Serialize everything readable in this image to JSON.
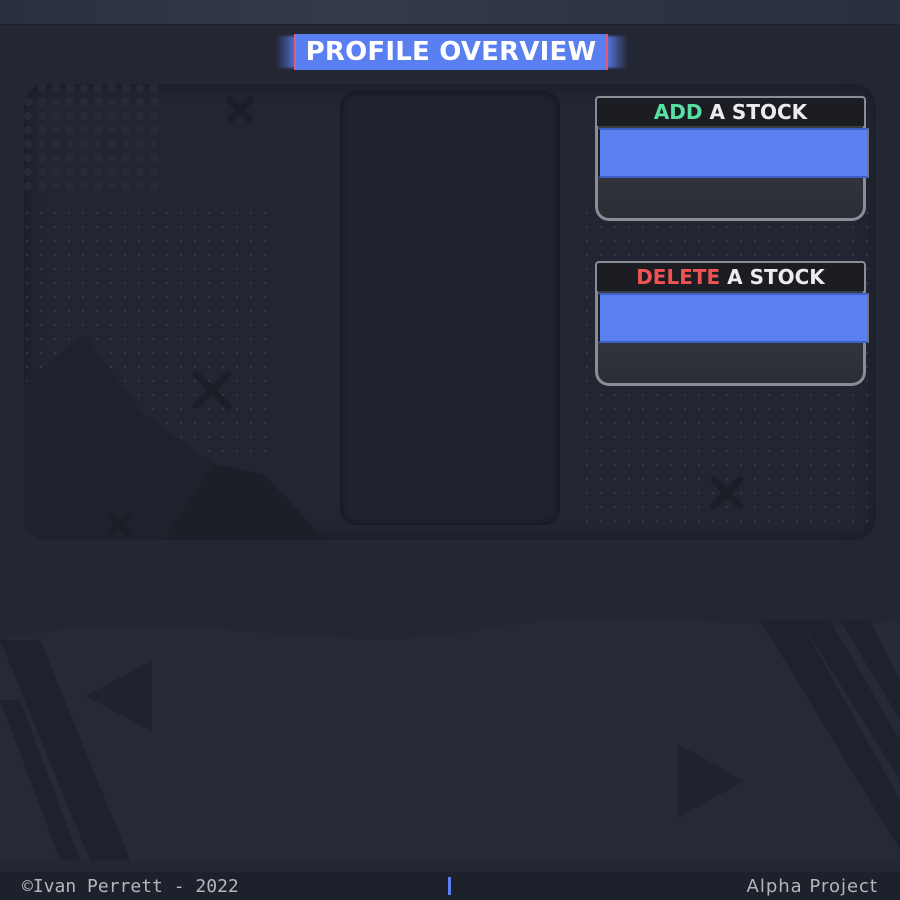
{
  "header": {
    "title": "PROFILE OVERVIEW"
  },
  "add_card": {
    "highlight": "ADD",
    "rest": " A STOCK",
    "input_value": ""
  },
  "delete_card": {
    "highlight": "DELETE",
    "rest": " A STOCK",
    "input_value": ""
  },
  "footer": {
    "copyright": "©Ivan Perrett - 2022",
    "project": "Alpha Project"
  },
  "colors": {
    "accent_blue": "#5b80f0",
    "add_green": "#58e0a2",
    "delete_red": "#ee5454",
    "title_border_pink": "#e35a7a",
    "background": "#232734"
  }
}
